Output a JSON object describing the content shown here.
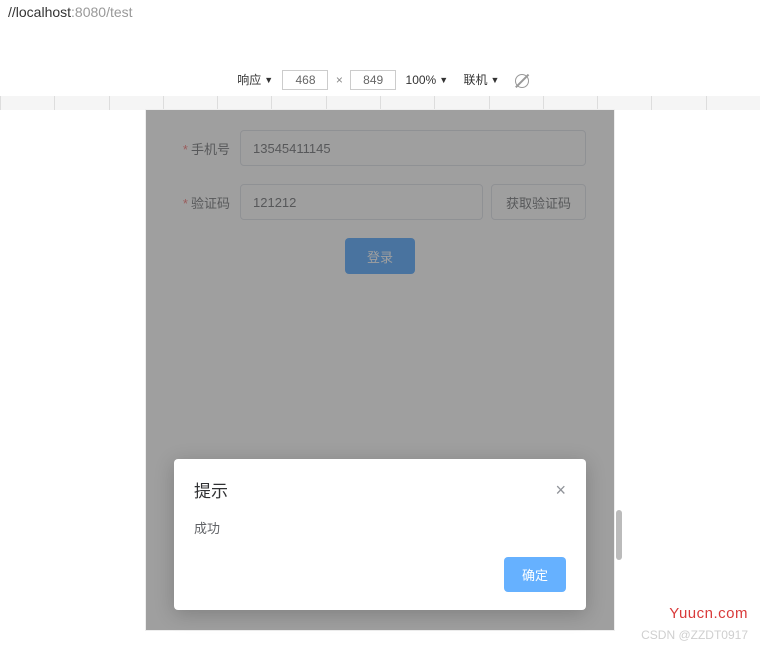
{
  "url": {
    "prefix": "//",
    "host": "localhost",
    "port_path": ":8080/test"
  },
  "devtools": {
    "responsive_label": "响应",
    "width": "468",
    "height": "849",
    "zoom": "100%",
    "network": "联机"
  },
  "form": {
    "phone_label": "手机号",
    "phone_value": "13545411145",
    "code_label": "验证码",
    "code_value": "121212",
    "get_code_btn": "获取验证码",
    "login_btn": "登录"
  },
  "dialog": {
    "title": "提示",
    "body": "成功",
    "ok": "确定"
  },
  "watermark": {
    "site": "Yuucn.com",
    "credit": "CSDN @ZZDT0917"
  }
}
